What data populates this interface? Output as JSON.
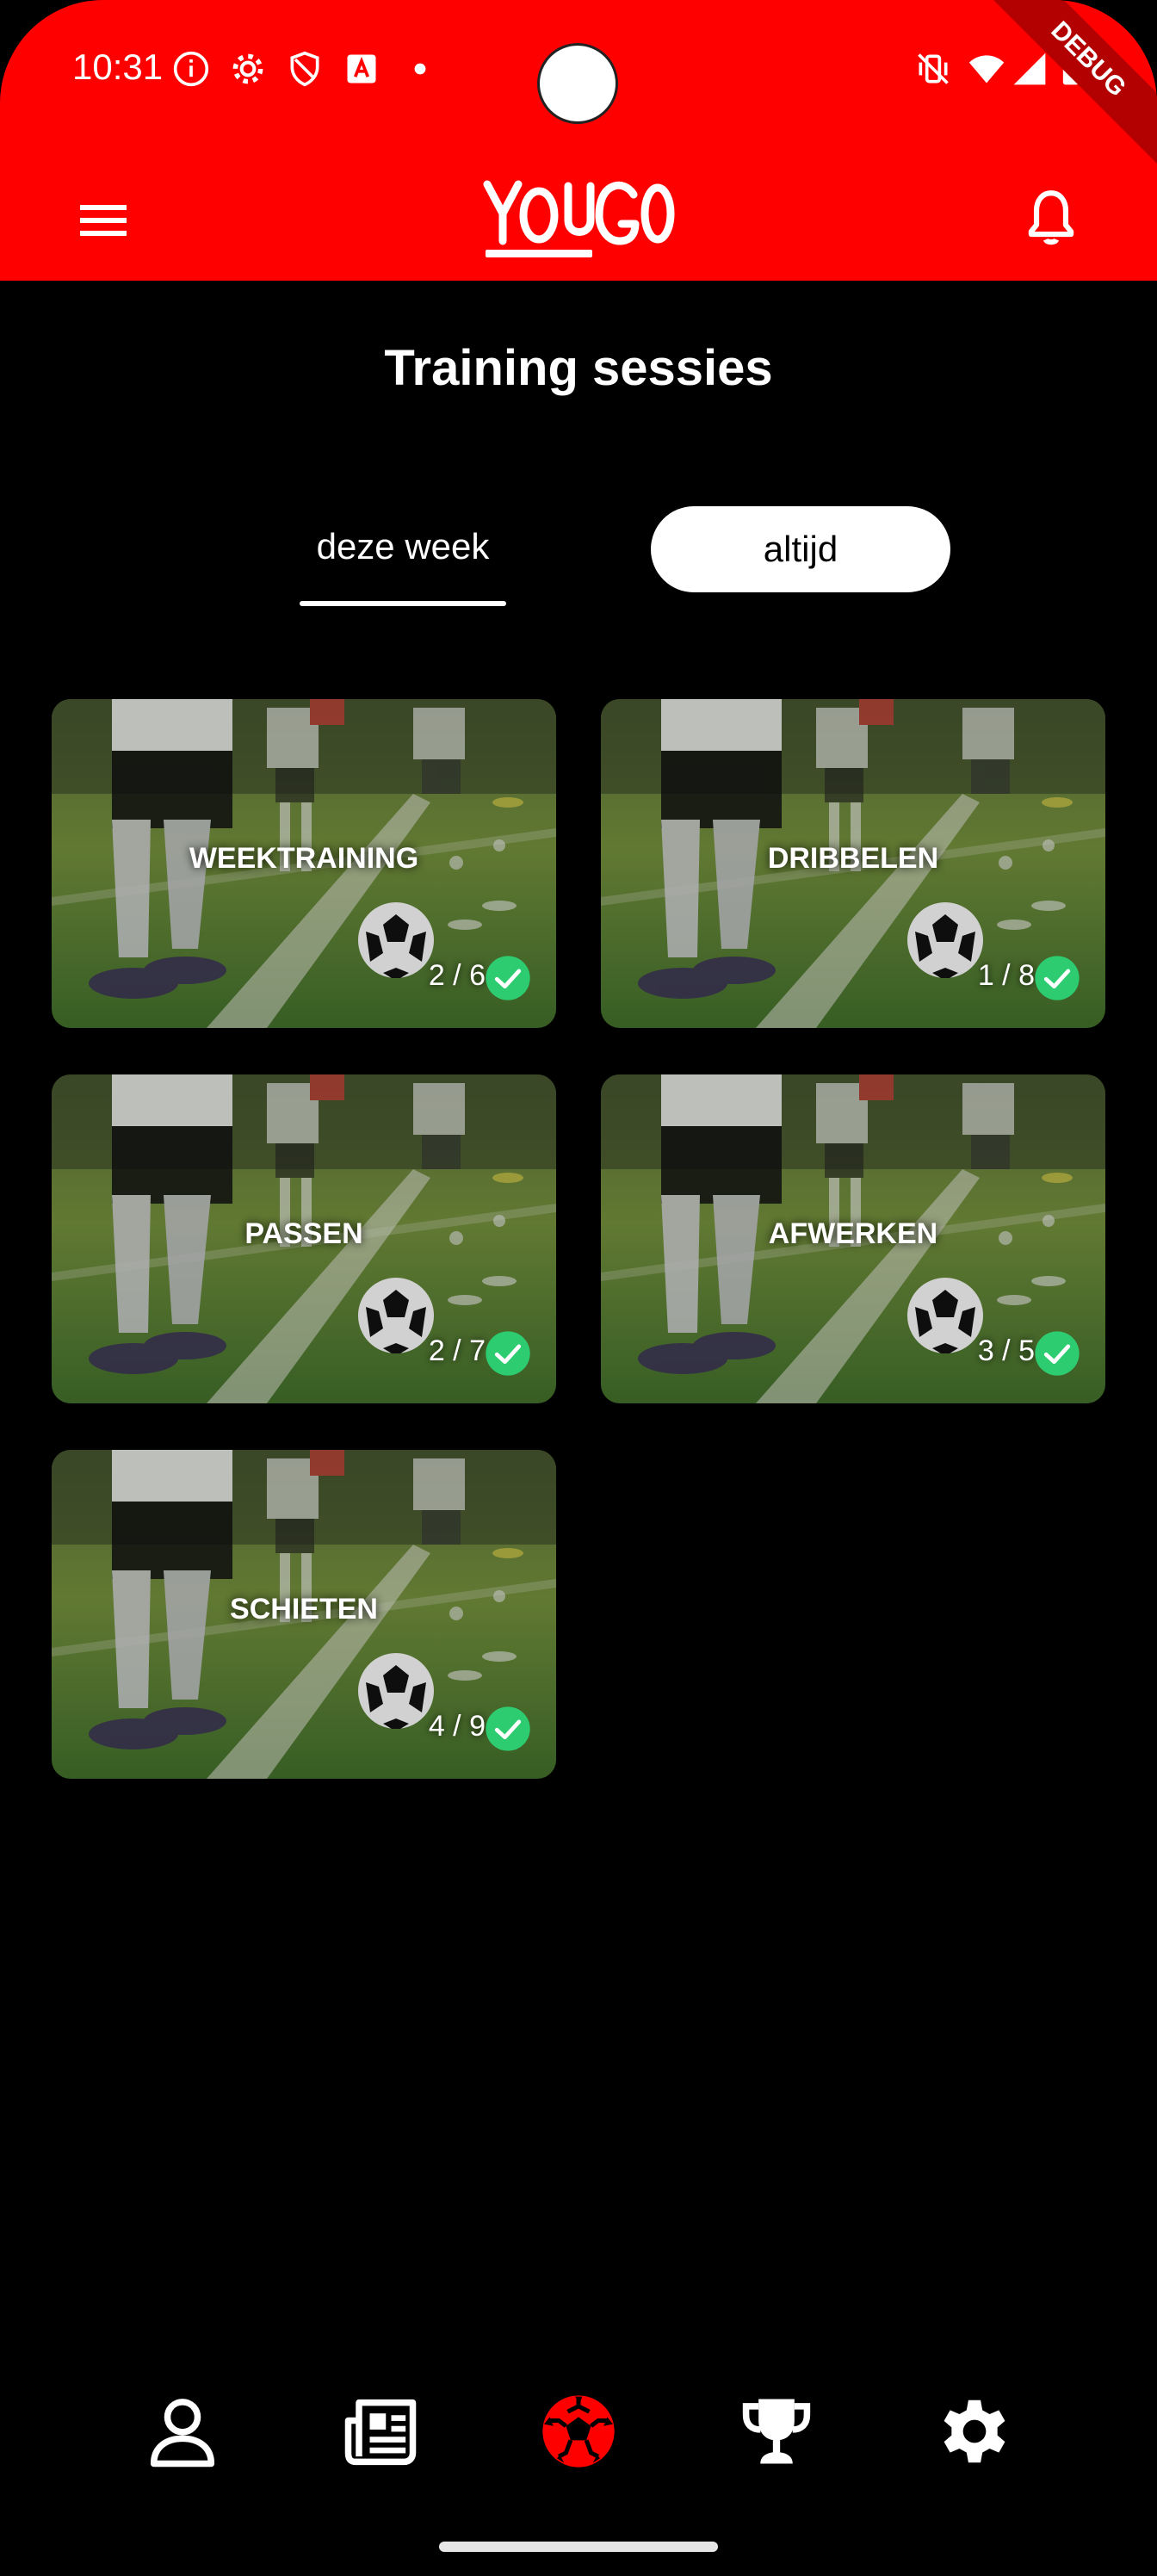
{
  "status_bar": {
    "time": "10:31",
    "debug_label": "DEBUG",
    "icons": [
      "info-icon",
      "settings-icon",
      "shield-icon",
      "a-icon",
      "dot-icon",
      "vibrate-icon",
      "wifi-icon",
      "signal-icon",
      "battery-icon"
    ]
  },
  "app_bar": {
    "logo_text": "YOUGO",
    "menu_icon": "hamburger-menu-icon",
    "bell_icon": "bell-icon"
  },
  "colors": {
    "brand_red": "#ff0000",
    "background": "#000000",
    "check_green": "#2ecc71"
  },
  "page_title": "Training sessies",
  "tabs": {
    "this_week": "deze week",
    "always": "altijd",
    "selected": "deze week"
  },
  "sessions": [
    {
      "label": "WEEKTRAINING",
      "count": "2 / 6"
    },
    {
      "label": "DRIBBELEN",
      "count": "1 / 8"
    },
    {
      "label": "PASSEN",
      "count": "2 / 7"
    },
    {
      "label": "AFWERKEN",
      "count": "3 / 5"
    },
    {
      "label": "SCHIETEN",
      "count": "4 / 9"
    }
  ],
  "bottom_nav": {
    "items": [
      "profile-icon",
      "news-icon",
      "soccer-ball-icon",
      "trophy-icon",
      "settings-icon"
    ],
    "active": "soccer-ball-icon"
  }
}
